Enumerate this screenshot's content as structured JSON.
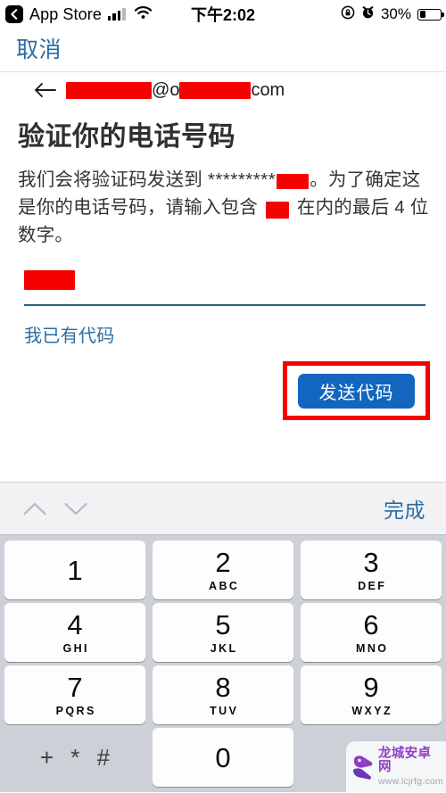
{
  "status_bar": {
    "back_label": "App Store",
    "back_icon": "chevron-left-icon",
    "signal_icon": "cellular-signal-icon",
    "wifi_icon": "wifi-icon",
    "time": "下午2:02",
    "rotation_lock_icon": "rotation-lock-icon",
    "alarm_icon": "alarm-clock-icon",
    "battery_percent": "30%",
    "battery_icon": "battery-icon"
  },
  "nav": {
    "cancel_label": "取消",
    "back_arrow_icon": "arrow-left-icon"
  },
  "account": {
    "email_domain_suffix": "com",
    "email_at": "@",
    "email_domain_first_char": "o",
    "redacted": true
  },
  "page": {
    "heading": "验证你的电话号码",
    "body_part1": "我们会将验证码发送到 ",
    "body_mask": "*********",
    "body_part2": "。为了确定这是你的电话号码，请输入包含 ",
    "body_part3": " 在内的最后 4 位数字。"
  },
  "form": {
    "input_value": "",
    "input_placeholder": "",
    "have_code_link": "我已有代码",
    "send_code_button": "发送代码"
  },
  "annotation": {
    "highlight_color": "#f60000",
    "target": "send-code-button"
  },
  "keyboard": {
    "prev_icon": "chevron-up-icon",
    "next_icon": "chevron-down-icon",
    "done_label": "完成",
    "keys": [
      [
        {
          "digit": "1",
          "letters": ""
        },
        {
          "digit": "2",
          "letters": "ABC"
        },
        {
          "digit": "3",
          "letters": "DEF"
        }
      ],
      [
        {
          "digit": "4",
          "letters": "GHI"
        },
        {
          "digit": "5",
          "letters": "JKL"
        },
        {
          "digit": "6",
          "letters": "MNO"
        }
      ],
      [
        {
          "digit": "7",
          "letters": "PQRS"
        },
        {
          "digit": "8",
          "letters": "TUV"
        },
        {
          "digit": "9",
          "letters": "WXYZ"
        }
      ],
      [
        {
          "digit": "+ * #",
          "letters": "",
          "blank": true
        },
        {
          "digit": "0",
          "letters": ""
        },
        {
          "digit": "",
          "letters": "",
          "blank": true
        }
      ]
    ]
  },
  "watermark": {
    "name": "龙城安卓网",
    "url": "www.lcjrfg.com",
    "color": "#8e3fc4"
  },
  "colors": {
    "link_blue": "#2b6ca3",
    "button_blue": "#1266c0",
    "redaction_red": "#f60000",
    "keyboard_bg": "#ced0d8",
    "toolbar_bg": "#f2f2f5"
  }
}
